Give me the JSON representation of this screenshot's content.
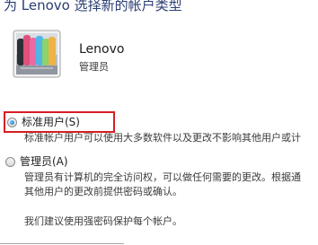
{
  "window": {
    "heading": "为 Lenovo 选择新的帐户类型"
  },
  "account": {
    "name": "Lenovo",
    "role": "管理员",
    "avatar_icon": "account-picture-icon"
  },
  "options": {
    "standard": {
      "label": "标准用户(S)",
      "checked": true,
      "description_lines": [
        "标准帐户用户可以使用大多数软件以及更改不影响其他用户或计"
      ]
    },
    "administrator": {
      "label": "管理员(A)",
      "checked": false,
      "description_lines": [
        "管理员有计算机的完全访问权，可以做任何需要的更改。根据通",
        "其他用户的更改前提供密码或确认。"
      ]
    }
  },
  "note": "我们建议使用强密码保护每个帐户。",
  "colors": {
    "heading": "#2b3d73",
    "highlight_border": "#d71d24",
    "text": "#1e1e1e",
    "muted_text": "#3b3b3b",
    "background": "#ffffff"
  }
}
